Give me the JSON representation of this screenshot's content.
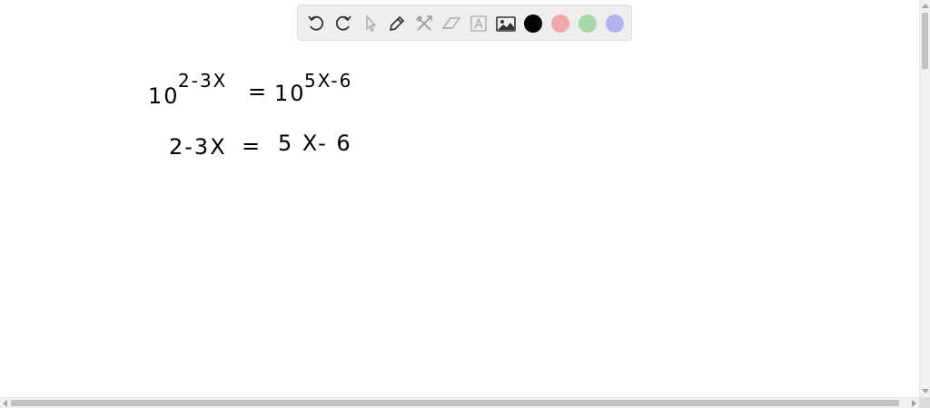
{
  "toolbar": {
    "tools": [
      {
        "name": "undo-icon"
      },
      {
        "name": "redo-icon"
      },
      {
        "name": "select-pointer-icon"
      },
      {
        "name": "pen-icon"
      },
      {
        "name": "tools-icon"
      },
      {
        "name": "eraser-icon"
      },
      {
        "name": "text-box-icon"
      },
      {
        "name": "image-icon"
      }
    ],
    "colors": [
      "#000000",
      "#f0a7a7",
      "#a8d8a8",
      "#b3b3f0"
    ],
    "selected_color": "#000000"
  },
  "canvas": {
    "line1": {
      "left_base": "10",
      "left_exponent": "2-3X",
      "equals": "=",
      "right_base": "10",
      "right_exponent": "5X-6"
    },
    "line2": {
      "left": "2-3X",
      "equals": "=",
      "right": "5 X- 6"
    }
  }
}
